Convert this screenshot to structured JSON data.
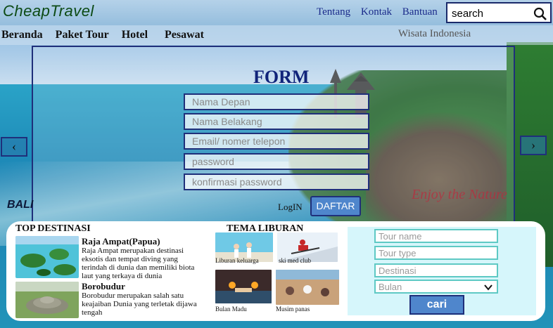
{
  "header": {
    "logo": "CheapTravel",
    "links": [
      "Tentang",
      "Kontak",
      "Bantuan"
    ],
    "search_placeholder": "search"
  },
  "nav": {
    "items": [
      "Beranda",
      "Paket Tour",
      "Hotel",
      "Pesawat"
    ],
    "tagline": "Wisata Indonesia"
  },
  "form": {
    "title": "FORM",
    "fields": [
      "Nama Depan",
      "Nama Belakang",
      "Email/ nomer telepon",
      "password",
      "konfirmasi password"
    ],
    "login_label": "LogIN",
    "submit_label": "DAFTAR"
  },
  "slider": {
    "prev_glyph": "‹",
    "next_glyph": "›",
    "location_text": "BALI",
    "overlay_text": "Enjoy the Nature"
  },
  "top_destinasi": {
    "title": "TOP DESTINASI",
    "items": [
      {
        "name": "Raja Ampat(Papua)",
        "desc": "Raja Ampat merupakan destinasi eksotis dan tempat diving yang terindah di dunia dan memiliki biota laut yang terkaya di dunia"
      },
      {
        "name": "Borobudur",
        "desc": "Borobudur merupakan salah satu keajaiban Dunia yang terletak dijawa tengah"
      }
    ]
  },
  "tema_liburan": {
    "title": "TEMA LIBURAN",
    "items": [
      "Liburan keluarga",
      "ski med club",
      "Bulan Madu",
      "Musim panas"
    ]
  },
  "tour_search": {
    "fields": [
      "Tour name",
      "Tour type",
      "Destinasi"
    ],
    "month_select": "Bulan",
    "submit_label": "cari"
  }
}
